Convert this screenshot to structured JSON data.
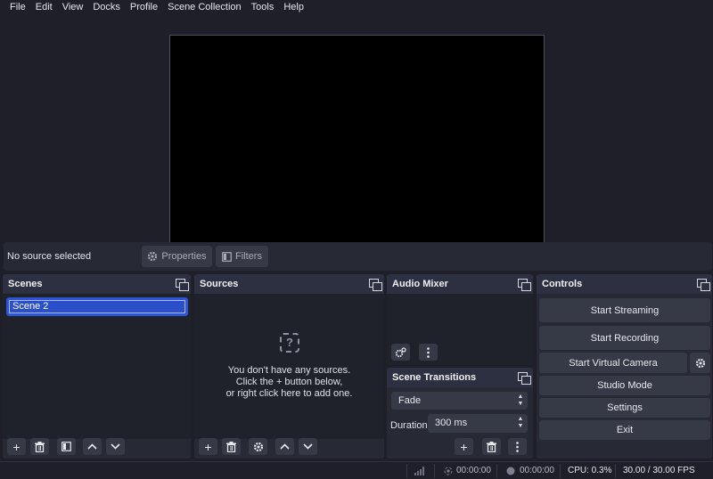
{
  "menu": [
    "File",
    "Edit",
    "View",
    "Docks",
    "Profile",
    "Scene Collection",
    "Tools",
    "Help"
  ],
  "context_bar": {
    "status": "No source selected",
    "properties_label": "Properties",
    "filters_label": "Filters"
  },
  "scenes": {
    "title": "Scenes",
    "items": [
      "Scene 2"
    ],
    "selected": "Scene 2"
  },
  "sources": {
    "title": "Sources",
    "empty_lines": [
      "You don't have any sources.",
      "Click the + button below,",
      "or right click here to add one."
    ]
  },
  "audio_mixer": {
    "title": "Audio Mixer"
  },
  "transitions": {
    "title": "Scene Transitions",
    "selected_transition": "Fade",
    "duration_label": "Duration",
    "duration_value": "300 ms"
  },
  "controls": {
    "title": "Controls",
    "start_streaming": "Start Streaming",
    "start_recording": "Start Recording",
    "start_virtual_camera": "Start Virtual Camera",
    "studio_mode": "Studio Mode",
    "settings": "Settings",
    "exit": "Exit"
  },
  "status_bar": {
    "stream_time": "00:00:00",
    "record_time": "00:00:00",
    "cpu": "CPU: 0.3%",
    "fps": "30.00 / 30.00 FPS"
  },
  "colors": {
    "background": "#1e1f29",
    "panel": "#272935",
    "button": "#363946",
    "selection": "#2d56d6"
  }
}
